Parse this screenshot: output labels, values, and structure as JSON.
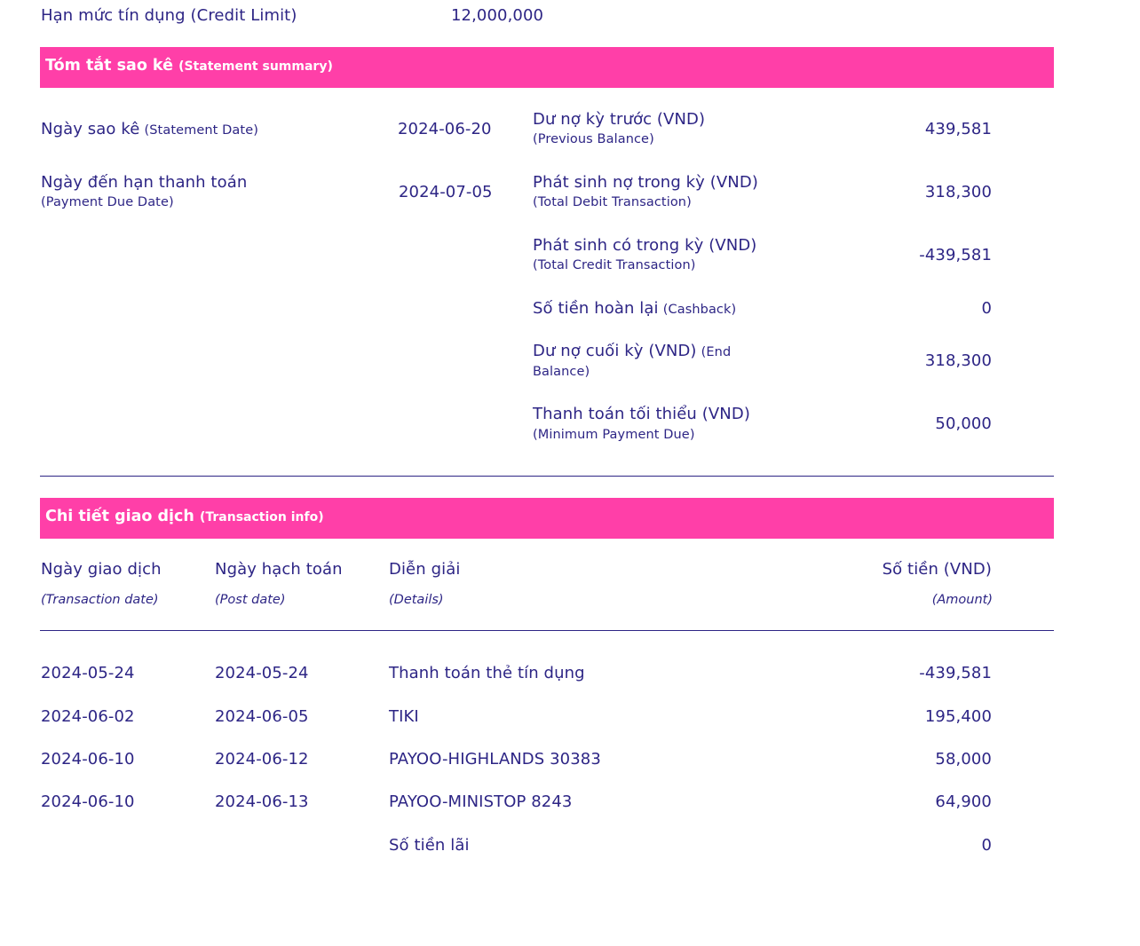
{
  "credit_limit": {
    "label": "Hạn mức tín dụng (Credit Limit)",
    "value": "12,000,000"
  },
  "summary_section": {
    "title": "Tóm tắt sao kê",
    "subtitle": "(Statement summary)"
  },
  "statement_date": {
    "label": "Ngày sao kê",
    "sublabel": "(Statement Date)",
    "value": "2024-06-20"
  },
  "due_date": {
    "label": "Ngày đến hạn thanh toán",
    "sublabel": "(Payment Due Date)",
    "value": "2024-07-05"
  },
  "summary_items": [
    {
      "label": "Dư nợ kỳ trước (VND)",
      "sublabel": "(Previous Balance)",
      "value": "439,581"
    },
    {
      "label": "Phát sinh nợ trong kỳ (VND)",
      "sublabel": "(Total Debit Transaction)",
      "value": "318,300"
    },
    {
      "label": "Phát sinh có trong kỳ (VND)",
      "sublabel": "(Total Credit Transaction)",
      "value": "-439,581"
    },
    {
      "label": "Số tiền hoàn lại",
      "sublabel": "(Cashback)",
      "value": "0"
    },
    {
      "label": "Dư nợ cuối kỳ (VND)",
      "sublabel": "(End",
      "sublabel2": "Balance)",
      "value": "318,300"
    },
    {
      "label": "Thanh toán tối thiểu (VND)",
      "sublabel": "(Minimum Payment Due)",
      "value": "50,000"
    }
  ],
  "transactions_section": {
    "title": "Chi tiết giao dịch",
    "subtitle": "(Transaction info)"
  },
  "columns": [
    {
      "label": "Ngày giao dịch",
      "sublabel": "(Transaction date)"
    },
    {
      "label": "Ngày hạch toán",
      "sublabel": "(Post date)"
    },
    {
      "label": "Diễn giải",
      "sublabel": "(Details)"
    },
    {
      "label": "Số tiền (VND)",
      "sublabel": "(Amount)"
    }
  ],
  "transactions": [
    {
      "transaction_date": "2024-05-24",
      "post_date": "2024-05-24",
      "details": "Thanh toán thẻ tín dụng",
      "amount": "-439,581"
    },
    {
      "transaction_date": "2024-06-02",
      "post_date": "2024-06-05",
      "details": "TIKI",
      "amount": "195,400"
    },
    {
      "transaction_date": "2024-06-10",
      "post_date": "2024-06-12",
      "details": "PAYOO-HIGHLANDS 30383",
      "amount": "58,000"
    },
    {
      "transaction_date": "2024-06-10",
      "post_date": "2024-06-13",
      "details": "PAYOO-MINISTOP 8243",
      "amount": "64,900"
    }
  ],
  "interest": {
    "label": "Số tiền lãi",
    "value": "0"
  },
  "colors": {
    "accent": "#ff3fa8",
    "text": "#2d2585",
    "header_text": "#ffffff"
  }
}
